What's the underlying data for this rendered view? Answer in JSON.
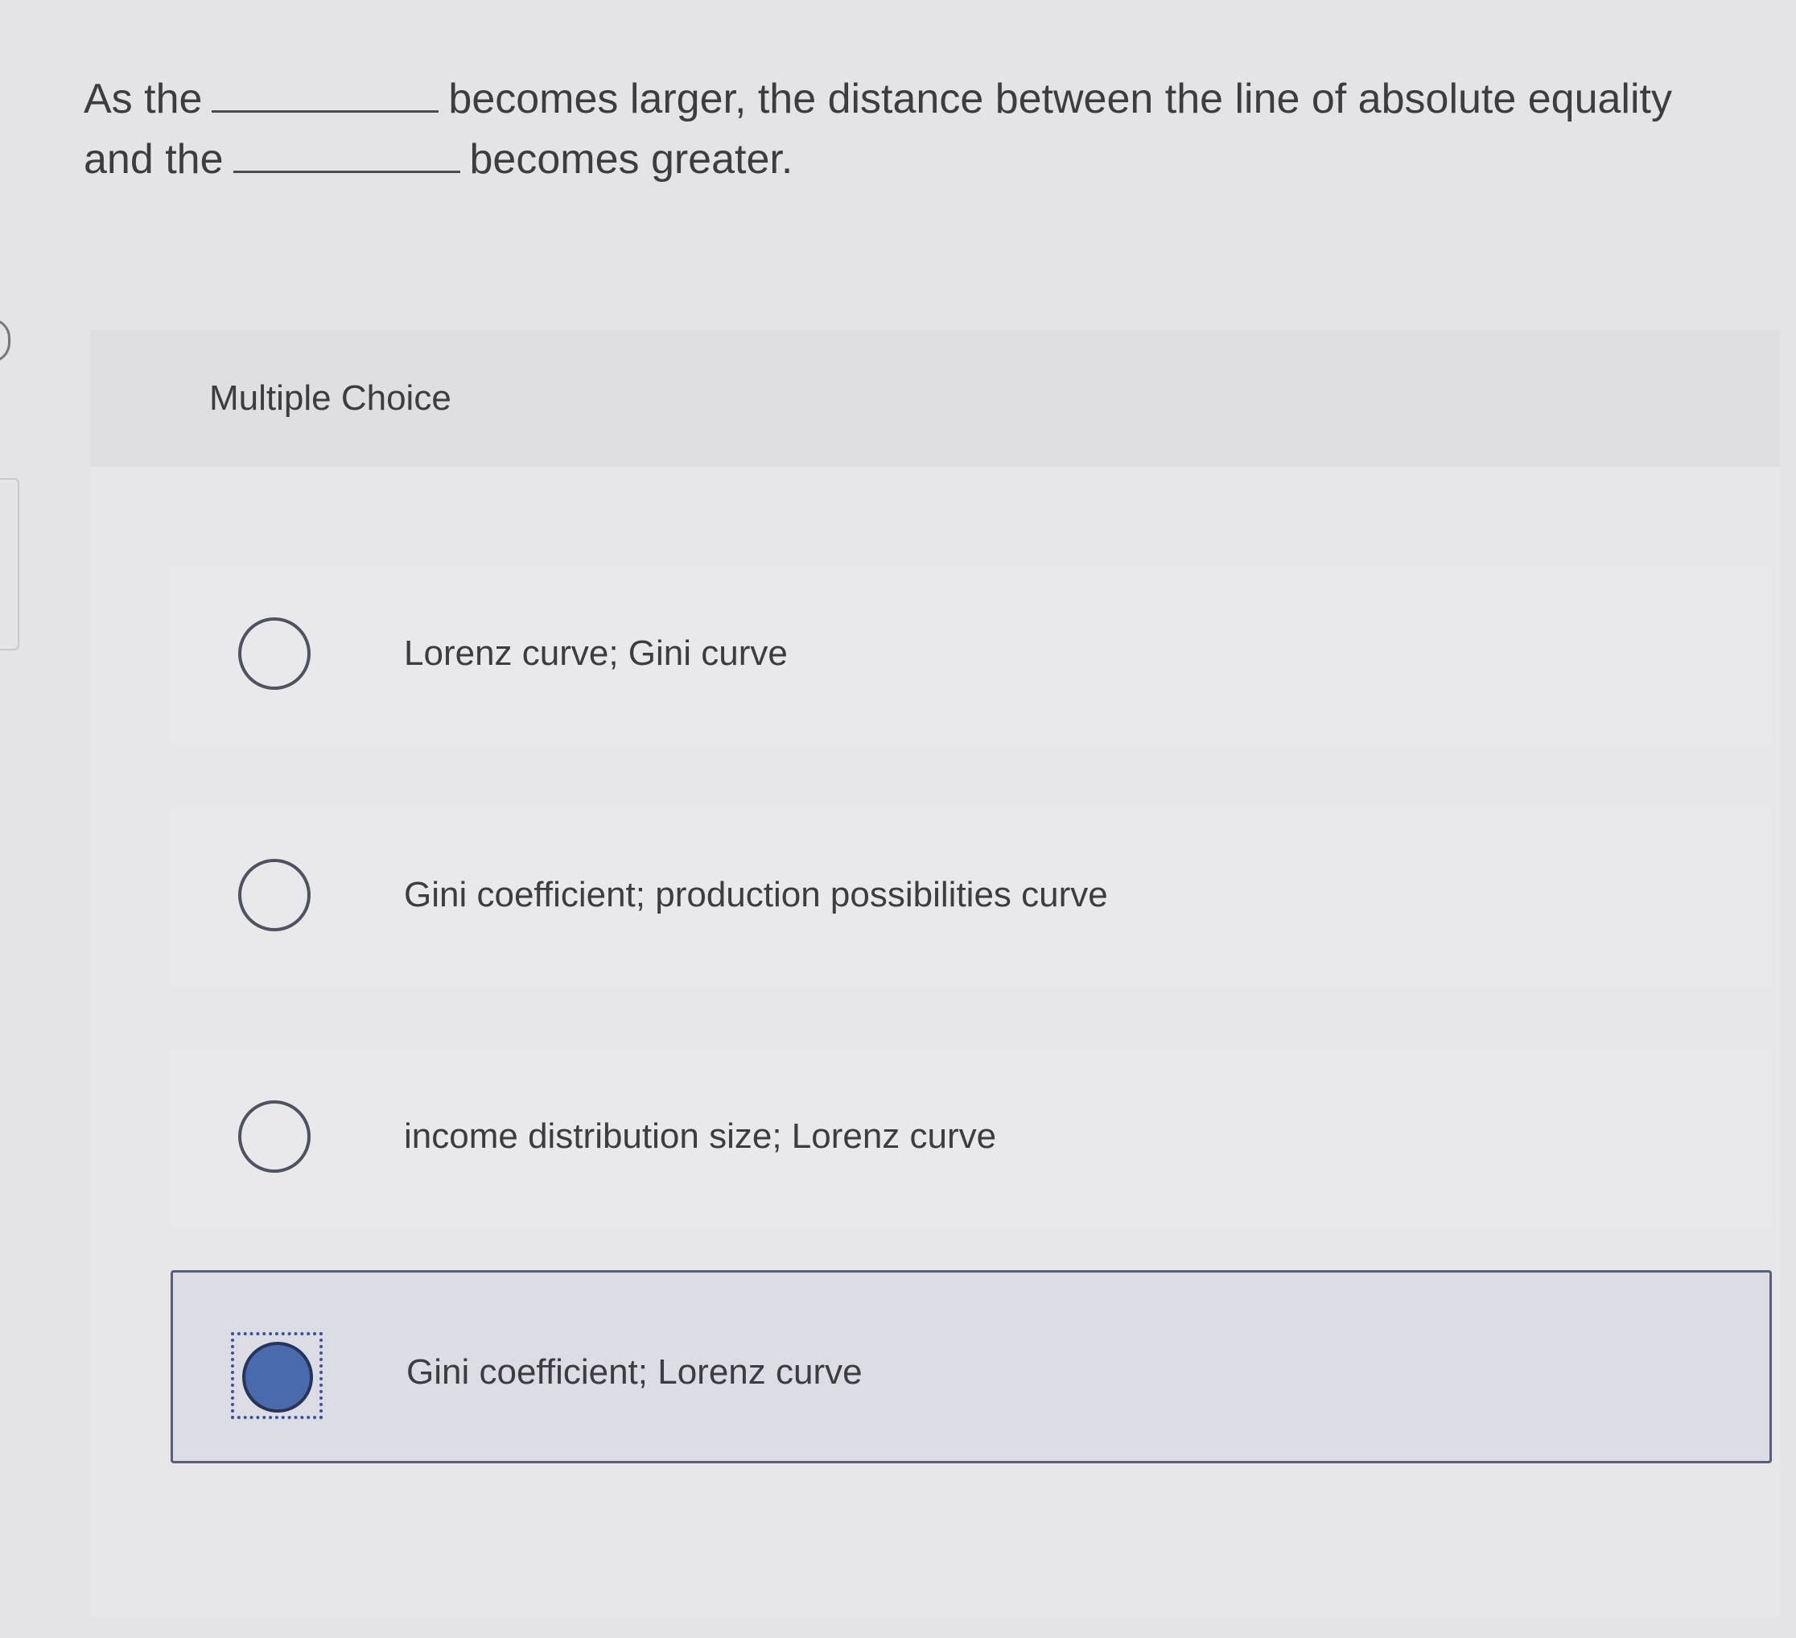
{
  "question": {
    "part1": "As the",
    "part2": "becomes larger, the distance between the line of absolute equality",
    "part3": "and the",
    "part4": "becomes greater."
  },
  "multiple_choice": {
    "header": "Multiple Choice",
    "options": [
      {
        "label": "Lorenz curve; Gini curve",
        "selected": false
      },
      {
        "label": "Gini coefficient; production possibilities curve",
        "selected": false
      },
      {
        "label": "income distribution size; Lorenz curve",
        "selected": false
      },
      {
        "label": "Gini coefficient; Lorenz curve",
        "selected": true
      }
    ]
  },
  "colors": {
    "selected_fill": "#4a6aae",
    "selected_border": "#55607d"
  }
}
